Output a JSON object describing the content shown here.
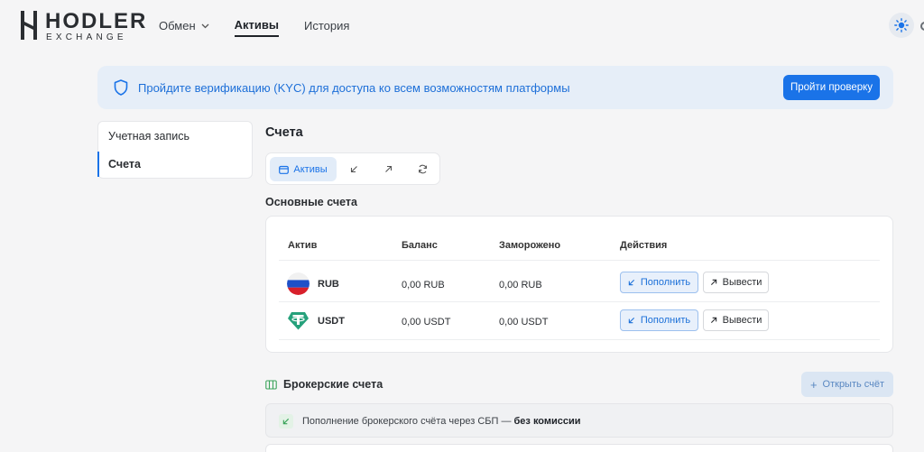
{
  "header": {
    "logo_name": "HODLER",
    "logo_sub": "EXCHANGE",
    "nav": [
      {
        "label": "Обмен"
      },
      {
        "label": "Активы"
      },
      {
        "label": "История"
      }
    ]
  },
  "kyc": {
    "text": "Пройдите верификацию (KYC) для доступа ко всем возможностям платформы",
    "button": "Пройти проверку"
  },
  "sidebar": {
    "items": [
      {
        "label": "Учетная запись"
      },
      {
        "label": "Счета"
      }
    ]
  },
  "main": {
    "title": "Счета",
    "tabs": [
      {
        "label": "Активы",
        "icon": "wallet-icon"
      },
      {
        "icon": "arrow-down-left-icon"
      },
      {
        "icon": "arrow-up-right-icon"
      },
      {
        "icon": "refresh-icon"
      }
    ],
    "main_accounts_title": "Основные счета",
    "table": {
      "headers": [
        "Актив",
        "Баланс",
        "Заморожено",
        "Действия"
      ],
      "rows": [
        {
          "asset": "RUB",
          "balance": "0,00 RUB",
          "frozen": "0,00 RUB",
          "deposit": "Пополнить",
          "withdraw": "Вывести",
          "icon": "rub-flag-icon"
        },
        {
          "asset": "USDT",
          "balance": "0,00 USDT",
          "frozen": "0,00 USDT",
          "deposit": "Пополнить",
          "withdraw": "Вывести",
          "icon": "tether-icon"
        }
      ]
    },
    "broker": {
      "title": "Брокерские счета",
      "open_button": "Открыть счёт",
      "notice_text": "Пополнение брокерского счёта через СБП — ",
      "notice_bold": "без комиссии"
    }
  },
  "colors": {
    "accent": "#1a73e8",
    "banner_bg": "#e6eef8",
    "page_bg": "#f5f5f6",
    "tether": "#26a17b"
  }
}
